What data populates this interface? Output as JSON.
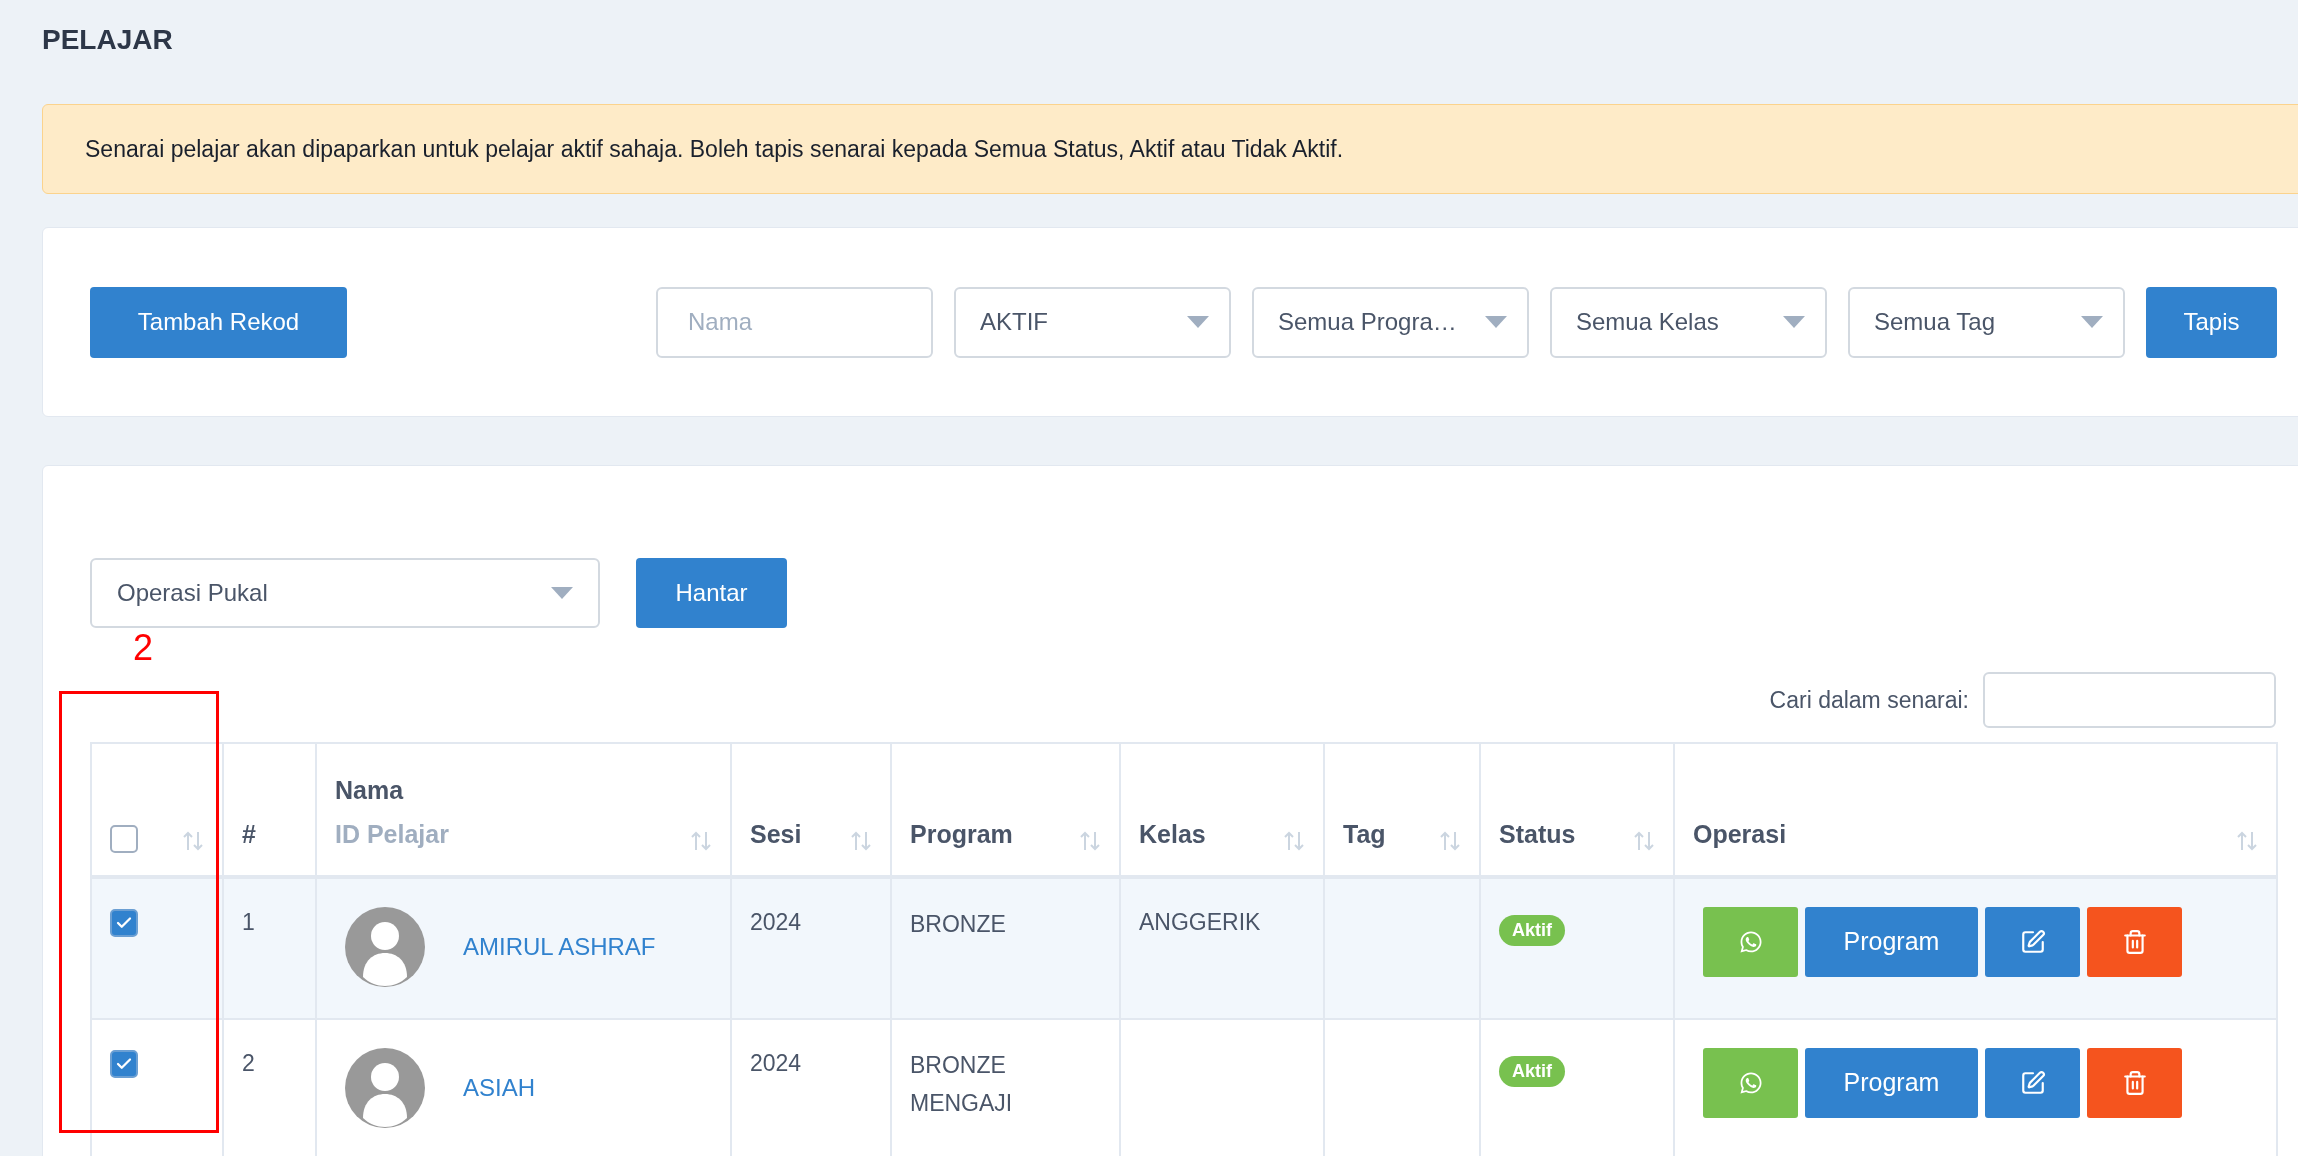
{
  "page_title": "PELAJAR",
  "notice": "Senarai pelajar akan dipaparkan untuk pelajar aktif sahaja. Boleh tapis senarai kepada Semua Status, Aktif atau Tidak Aktif.",
  "filters": {
    "add_button": "Tambah Rekod",
    "name_field": {
      "placeholder": "Nama"
    },
    "selects": [
      "AKTIF",
      "Semua Progra…",
      "Semua Kelas",
      "Semua Tag"
    ],
    "filter_button": "Tapis"
  },
  "bulk": {
    "select": "Operasi Pukal",
    "submit_button": "Hantar"
  },
  "annotation": {
    "label": "2"
  },
  "search": {
    "label": "Cari dalam senarai:"
  },
  "table": {
    "columns": [
      {
        "kind": "checkbox",
        "checked": false,
        "sortable": true
      },
      {
        "kind": "text",
        "label": "#",
        "sortable": false
      },
      {
        "kind": "stacked",
        "label": "Nama",
        "sublabel": "ID Pelajar",
        "sortable": true
      },
      {
        "kind": "text",
        "label": "Sesi",
        "sortable": true
      },
      {
        "kind": "text",
        "label": "Program",
        "sortable": true
      },
      {
        "kind": "text",
        "label": "Kelas",
        "sortable": true
      },
      {
        "kind": "text",
        "label": "Tag",
        "sortable": true
      },
      {
        "kind": "text",
        "label": "Status",
        "sortable": true
      },
      {
        "kind": "text",
        "label": "Operasi",
        "sortable": true
      }
    ],
    "rows": [
      {
        "checked": true,
        "number": "1",
        "name": "AMIRUL ASHRAF",
        "sesi": "2024",
        "program": "BRONZE",
        "kelas": "ANGGERIK",
        "status": "Aktif",
        "program_button": "Program"
      },
      {
        "checked": true,
        "number": "2",
        "name": "ASIAH",
        "sesi": "2024",
        "program": "BRONZE MENGAJI",
        "status": "Aktif",
        "program_button": "Program"
      }
    ]
  }
}
